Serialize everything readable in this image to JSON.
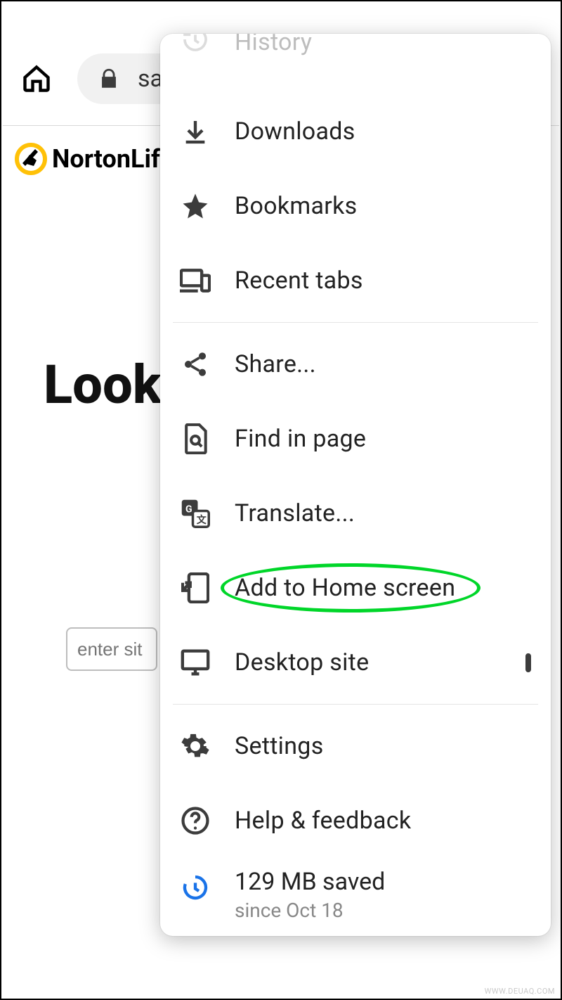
{
  "address_bar": {
    "url_fragment": "sa"
  },
  "page": {
    "brand": "NortonLife",
    "heading_fragment": "Look",
    "site_input_placeholder": "enter sit"
  },
  "menu": {
    "items": [
      {
        "id": "history",
        "label": "History",
        "icon": "history-icon"
      },
      {
        "id": "downloads",
        "label": "Downloads",
        "icon": "download-icon"
      },
      {
        "id": "bookmarks",
        "label": "Bookmarks",
        "icon": "star-icon"
      },
      {
        "id": "recent-tabs",
        "label": "Recent tabs",
        "icon": "devices-icon"
      },
      {
        "id": "share",
        "label": "Share...",
        "icon": "share-icon"
      },
      {
        "id": "find-in-page",
        "label": "Find in page",
        "icon": "find-icon"
      },
      {
        "id": "translate",
        "label": "Translate...",
        "icon": "translate-icon"
      },
      {
        "id": "add-home",
        "label": "Add to Home screen",
        "icon": "add-home-icon"
      },
      {
        "id": "desktop-site",
        "label": "Desktop site",
        "icon": "desktop-icon",
        "checked": false
      },
      {
        "id": "settings",
        "label": "Settings",
        "icon": "gear-icon"
      },
      {
        "id": "help",
        "label": "Help & feedback",
        "icon": "help-icon"
      }
    ],
    "data_saved": {
      "amount": "129 MB saved",
      "since": "since Oct 18"
    }
  },
  "annotation": {
    "highlight_item_id": "add-home"
  },
  "watermark": "WWW.DEUAQ.COM"
}
